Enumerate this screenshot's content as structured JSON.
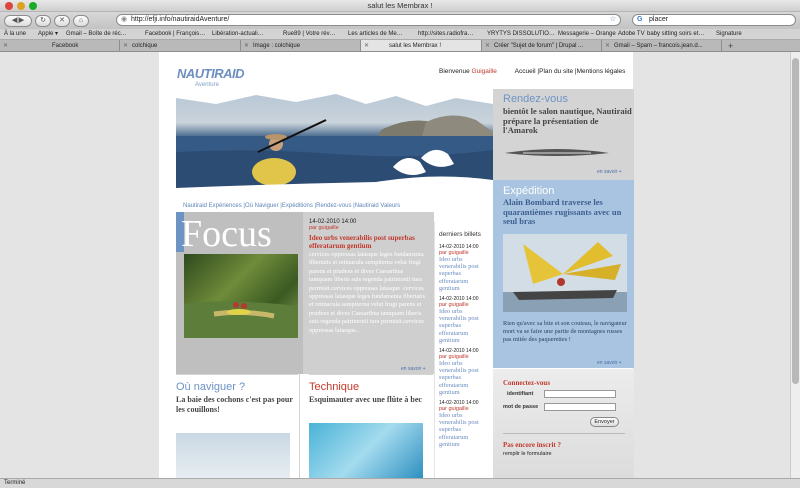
{
  "window": {
    "title": "salut les Membrax !"
  },
  "toolbar": {
    "url": "http://efji.info/nautiraidAventure/",
    "search_value": "placer"
  },
  "bookmarks": [
    "À la une",
    "Apple ▾",
    "Gmail – Boîte de réc…",
    "Facebook | François…",
    "Libération-actuali…",
    "Rue89 | Votre rév…",
    "Les articles de Me…",
    "http://sites.radiofra…",
    "YRYTYS DISSOLUTIO…",
    "Messagerie – Orange",
    "Adobe TV",
    "baby sitting soirs et…",
    "Signature"
  ],
  "tabs": [
    {
      "label": "Facebook",
      "active": false
    },
    {
      "label": "colchique",
      "active": false
    },
    {
      "label": "Image : colchique",
      "active": false
    },
    {
      "label": "salut les Membrax !",
      "active": true
    },
    {
      "label": "Créer \"Sujet de forum\" | Drupal ...",
      "active": false
    },
    {
      "label": "Gmail – Spam – francois.jean.d...",
      "active": false
    }
  ],
  "status": "Terminé",
  "site": {
    "logo": "NAUTIRAID",
    "logo_sub": "Aventure",
    "toplinks": {
      "welcome": "Bienvenue",
      "user": "Guigaille",
      "home": "Accueil",
      "plan": "Plan du site",
      "legal": "Mentions légales"
    },
    "subnav": [
      "Nautiraid Expériences",
      "Où Naviguer",
      "Expéditions",
      "Rendez-vous",
      "Nautiraid Valeurs"
    ],
    "focus": {
      "title": "Focus",
      "date": "14-02-2010 14:00",
      "byline": "par guigaille",
      "headline": "Ideo urbs venerabilis post superbas efferatarum gentium",
      "body": "cervices oppressas latasque leges fundamenta libertatis et retinacula sempiterna velut frugi parens et prudens et dives Caesaribus tamquam liberis suis regenda patrimonii iura permisit.cervices oppressas latasque .cervices oppressas latasque leges fundamenta libertatis et retinacula sempiterna velut frugi parens et prudens et dives Caesaribus tamquam liberis suis regenda patrimonii iura permisit.cervices oppressas latasque..",
      "more": "en savoir +"
    },
    "billets": {
      "heading": "derniers billets",
      "items": [
        {
          "date": "14-02-2010 14:00",
          "by": "par guigaille",
          "title": "Ideo urbs venerabilis post superbas efferatarum gentium"
        },
        {
          "date": "14-02-2010 14:00",
          "by": "par guigaille",
          "title": "Ideo urbs venerabilis post superbas efferatarum gentium"
        },
        {
          "date": "14-02-2010 14:00",
          "by": "par guigaille",
          "title": "Ideo urbs venerabilis post superbas efferatarum gentium"
        },
        {
          "date": "14-02-2010 14:00",
          "by": "par guigaille",
          "title": "Ideo urbs venerabilis post superbas efferatarum gentium"
        }
      ]
    },
    "rdv": {
      "heading": "Rendez-vous",
      "text": "bientôt le salon nautique, Nautiraid prépare la présentation de l'Amarok",
      "more": "en savoir +"
    },
    "expedition": {
      "heading": "Expédition",
      "headline": "Alain Bombard traverse les quarantièmes rugissants avec un seul bras",
      "body": "Rien qu'avec sa bite et son couteau, le navigateur mort va se faire une partie de montagnes russes pas mitée des paquerettes !",
      "more": "en savoir +"
    },
    "connect": {
      "heading": "Connectez-vous",
      "id_label": "identifiant",
      "pw_label": "mot de passe",
      "send": "Envoyer",
      "signup_heading": "Pas encore inscrit ?",
      "signup_link": "remplir le formulaire"
    },
    "naviguer": {
      "heading": "Où naviguer ?",
      "text": "La baie des cochons c'est pas pour les couillons!"
    },
    "technique": {
      "heading": "Technique",
      "text": "Esquimauter avec une flûte à bec"
    }
  }
}
